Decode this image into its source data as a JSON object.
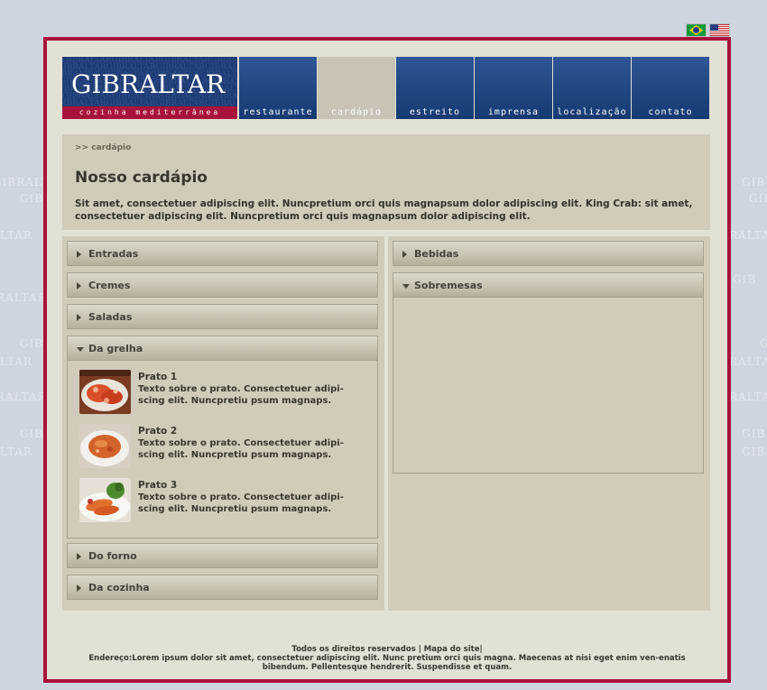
{
  "header": {
    "logo_name": "GIBRALTAR",
    "logo_sub": "cozinha mediterrânea",
    "logo_pattern": "GIBRALTARGIBRALTARGIBRALTARGIBRALTAR"
  },
  "watermark": {
    "text1": "GIBRALTAR",
    "text2": "GIB",
    "text3": "LTAR",
    "text4": "RALTAR"
  },
  "nav": {
    "items": [
      {
        "label": "restaurante"
      },
      {
        "label": "cardápio"
      },
      {
        "label": "estreito"
      },
      {
        "label": "imprensa"
      },
      {
        "label": "localização"
      },
      {
        "label": "contato"
      }
    ]
  },
  "breadcrumb": ">> cardápio",
  "page": {
    "title": "Nosso cardápio",
    "intro": "Sit amet, consectetuer adipiscing elit. Nuncpretium orci quis magnapsum dolor adipiscing elit. King Crab: sit amet, consectetuer adipiscing elit. Nuncpretium orci quis magnapsum dolor adipiscing elit."
  },
  "menu_left": {
    "entradas": "Entradas",
    "cremes": "Cremes",
    "saladas": "Saladas",
    "grelha": "Da grelha",
    "forno": "Do forno",
    "cozinha": "Da cozinha"
  },
  "dishes": [
    {
      "title": "Prato 1",
      "text": "Texto sobre o prato. Consectetuer adipi-scing elit. Nuncpretiu psum magnaps."
    },
    {
      "title": "Prato 2",
      "text": "Texto sobre o prato. Consectetuer adipi-scing elit. Nuncpretiu psum magnaps."
    },
    {
      "title": "Prato 3",
      "text": "Texto sobre o prato. Consectetuer adipi-scing elit. Nuncpretiu psum magnaps."
    }
  ],
  "menu_right": {
    "bebidas": "Bebidas",
    "sobremesas": "Sobremesas"
  },
  "footer": {
    "rights": "Todos os direitos reservados",
    "sep": " | ",
    "sitemap": "Mapa do site",
    "sep2": "|",
    "address": "Endereço:Lorem ipsum dolor sit amet, consectetuer adipiscing elit. Nunc pretium orci quis magna. Maecenas at nisi eget enim ven-enatis bibendum. Pellentesque hendrerit. Suspendisse et quam."
  },
  "colors": {
    "frame": "#a8133c",
    "nav_blue": "#1e3b73",
    "panel": "#d0cbba"
  }
}
